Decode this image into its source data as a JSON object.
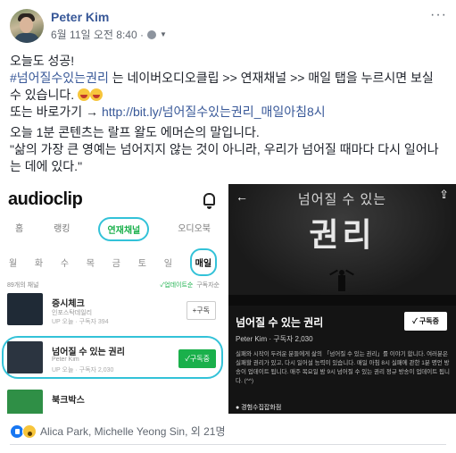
{
  "post": {
    "author": "Peter Kim",
    "timestamp": "6월 11일 오전 8:40 · ",
    "more": "···",
    "lines": {
      "l1": "오늘도 성공!",
      "l2_tag": "#넘어질수있는권리",
      "l2_rest": " 는 네이버오디오클립 >> 연재채널 >> 매일 탭을 누르시면 보실 수 있습니다. ",
      "l3_prefix": "또는 바로가기 → ",
      "l3_link": "http://bit.ly/넘어질수있는권리_매일아침8시",
      "l4": "오늘 1분 콘텐츠는 랄프 왈도 에머슨의 말입니다.",
      "l5": "\"삶의 가장 큰 영예는 넘어지지 않는 것이 아니라, 우리가 넘어질 때마다 다시 일어나는 데에 있다.\""
    }
  },
  "left_shot": {
    "logo": "audioclip",
    "tabs": [
      "홈",
      "랭킹",
      "연재채널",
      "오디오북"
    ],
    "active_tab": "연재채널",
    "days": [
      "월",
      "화",
      "수",
      "목",
      "금",
      "토",
      "일",
      "매일"
    ],
    "active_day": "매일",
    "count": "89개의 채널",
    "sort1": "✓업데이트순",
    "sort2": "구독자순",
    "rows": [
      {
        "title": "증시체크",
        "sub": "인포스탁데일리",
        "sub2": "UP 오늘 · 구독자 394",
        "btn": "+구독"
      },
      {
        "title": "넘어질 수 있는 권리",
        "sub": "Peter Kim",
        "sub2": "UP 오늘 · 구독자 2,030",
        "btn": "✓구독중"
      },
      {
        "title": "북크박스",
        "sub": "",
        "sub2": "",
        "btn": ""
      }
    ]
  },
  "right_shot": {
    "title_small": "넘어질 수 있는",
    "title_big": "권리",
    "heading": "넘어질 수 있는 권리",
    "author": "Peter Kim · 구독자 2,030",
    "subscribe": "✓ 구독중",
    "description": "실패와 시작이 두려운 분들에게 삶의 「넘어질 수 있는 권리」를 이야기 합니다. 여러분은 실패할 권리가 있고, 다시 일어설 능력이 있습니다. 매일 아침 8시 실패에 관한 1분 명언 방송이 업데이트 됩니다. 매주 목요일 밤 9시 넘어질 수 있는 권리 정규 방송이 업데이트 됩니다. (^^)",
    "more": "● 경험수집잡화점"
  },
  "reactions": {
    "text": "Alica Park, Michelle Yeong Sin, 외 21명"
  },
  "colors": {
    "link": "#385898",
    "highlight": "#33c2d8",
    "green": "#1ab04b"
  }
}
